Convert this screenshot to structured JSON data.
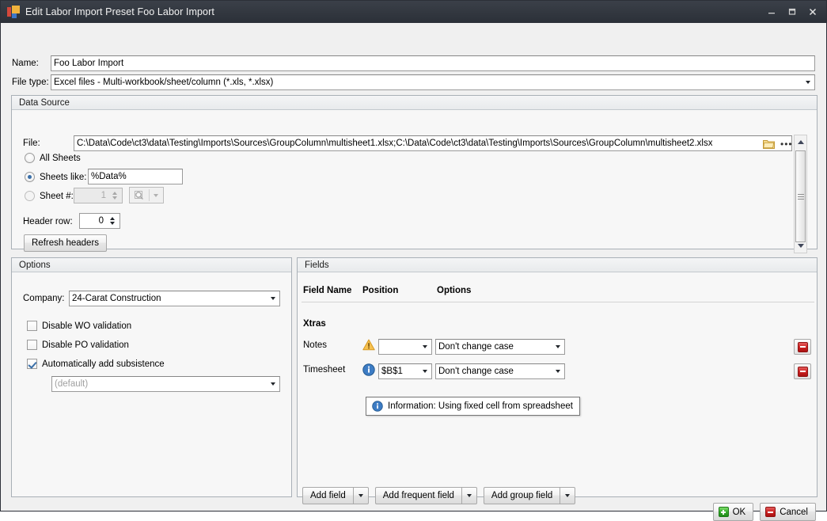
{
  "window": {
    "title": "Edit Labor Import Preset Foo Labor Import",
    "icon": "app-blocks-icon",
    "minimize_label": "–",
    "maximize_label": "❐",
    "close_label": "✕"
  },
  "top": {
    "name_label": "Name:",
    "name_value": "Foo Labor Import",
    "filetype_label": "File type:",
    "filetype_value": "Excel files - Multi-workbook/sheet/column (*.xls, *.xlsx)"
  },
  "data_source": {
    "title": "Data Source",
    "file_label": "File:",
    "file_value": "C:\\Data\\Code\\ct3\\data\\Testing\\Imports\\Sources\\GroupColumn\\multisheet1.xlsx;C:\\Data\\Code\\ct3\\data\\Testing\\Imports\\Sources\\GroupColumn\\multisheet2.xlsx",
    "browse_folder_icon": "folder-icon",
    "browse_ellipsis": "•••",
    "all_sheets_label": "All Sheets",
    "all_sheets_checked": false,
    "sheets_like_label": "Sheets like:",
    "sheets_like_checked": true,
    "sheets_like_value": "%Data%",
    "sheet_num_label": "Sheet #:",
    "sheet_num_checked": false,
    "sheet_num_value": "1",
    "sheet_search_icon": "magnifier-icon",
    "header_row_label": "Header row:",
    "header_row_value": "0",
    "refresh_headers_label": "Refresh headers"
  },
  "options": {
    "title": "Options",
    "company_label": "Company:",
    "company_value": "24-Carat Construction",
    "disable_wo_label": "Disable WO validation",
    "disable_wo_checked": false,
    "disable_po_label": "Disable PO validation",
    "disable_po_checked": false,
    "auto_subsistence_label": "Automatically add subsistence",
    "auto_subsistence_checked": true,
    "subsistence_value": "(default)"
  },
  "fields": {
    "title": "Fields",
    "columns": [
      "Field Name",
      "Position",
      "Options"
    ],
    "group_label": "Xtras",
    "rows": [
      {
        "name": "Notes",
        "status_icon": "warning-icon",
        "position": "",
        "option": "Don't change case",
        "remove_icon": "remove-icon"
      },
      {
        "name": "Timesheet",
        "status_icon": "info-icon",
        "position": "$B$1",
        "option": "Don't change case",
        "remove_icon": "remove-icon"
      }
    ],
    "tooltip": {
      "icon": "info-icon",
      "text": "Information: Using fixed cell from spreadsheet"
    },
    "add_field_label": "Add field",
    "add_frequent_field_label": "Add frequent field",
    "add_group_field_label": "Add group field"
  },
  "footer": {
    "ok_label": "OK",
    "cancel_label": "Cancel"
  },
  "colors": {
    "titlebar": "#333840",
    "panel_bg": "#f7f7f7",
    "client_bg": "#f0f0f0",
    "accent_blue": "#3a6fa8",
    "warning": "#f0ad3c",
    "error_red": "#cd2222",
    "ok_green": "#36ab2c"
  }
}
